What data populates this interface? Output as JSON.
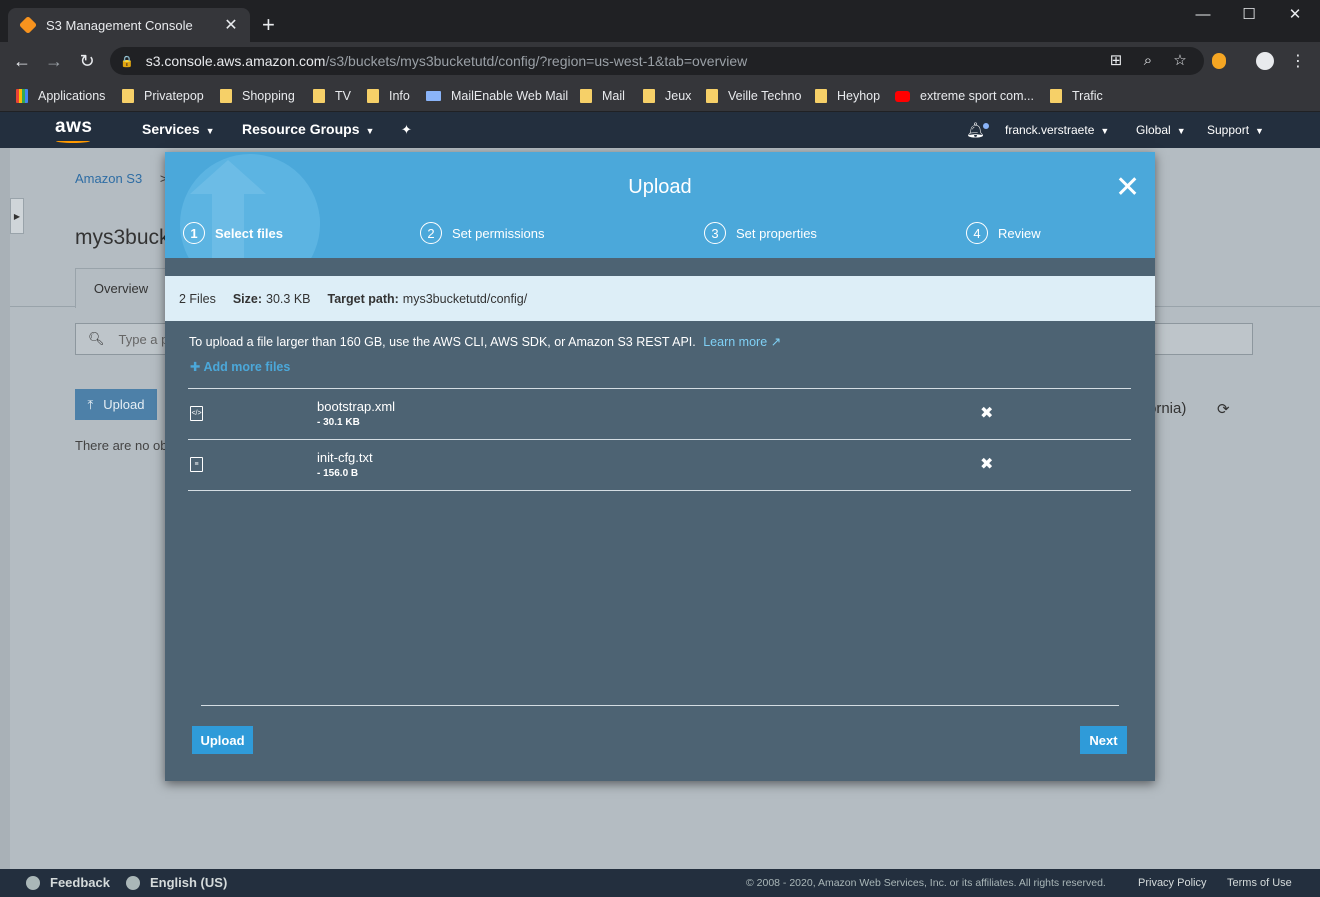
{
  "browser": {
    "tab_title": "S3 Management Console",
    "tab_close": "✕",
    "new_tab": "+",
    "window_controls": [
      "—",
      "☐",
      "✕"
    ],
    "url_host": "s3.console.aws.amazon.com",
    "url_path": "/s3/buckets/mys3bucketutd/config/?region=us-west-1&tab=overview",
    "bookmarks": [
      {
        "label": "Applications",
        "icon": "grid"
      },
      {
        "label": "Privatepop",
        "icon": "folder"
      },
      {
        "label": "Shopping",
        "icon": "folder"
      },
      {
        "label": "TV",
        "icon": "folder"
      },
      {
        "label": "Info",
        "icon": "folder"
      },
      {
        "label": "MailEnable Web Mail",
        "icon": "mail"
      },
      {
        "label": "Mail",
        "icon": "folder"
      },
      {
        "label": "Jeux",
        "icon": "folder"
      },
      {
        "label": "Veille Techno",
        "icon": "folder"
      },
      {
        "label": "Heyhop",
        "icon": "folder"
      },
      {
        "label": "extreme sport com...",
        "icon": "youtube"
      },
      {
        "label": "Trafic",
        "icon": "folder"
      }
    ]
  },
  "aws_nav": {
    "logo": "aws",
    "services": "Services",
    "resource_groups": "Resource Groups",
    "user": "franck.verstraete",
    "region": "Global",
    "support": "Support"
  },
  "background": {
    "breadcrumb": "Amazon S3",
    "breadcrumb_sep": ">",
    "bucket_title": "mys3buck",
    "tab_overview": "Overview",
    "search_placeholder": "Type a pr",
    "upload_label": "Upload",
    "region_text": "ornia)",
    "empty_text": "There are no obj"
  },
  "modal": {
    "title": "Upload",
    "steps": [
      {
        "num": "1",
        "label": "Select files"
      },
      {
        "num": "2",
        "label": "Set permissions"
      },
      {
        "num": "3",
        "label": "Set properties"
      },
      {
        "num": "4",
        "label": "Review"
      }
    ],
    "summary": {
      "files": "2 Files",
      "size_label": "Size:",
      "size_value": "30.3 KB",
      "path_label": "Target path:",
      "path_value": "mys3bucketutd/config/"
    },
    "info": "To upload a file larger than 160 GB, use the AWS CLI, AWS SDK, or Amazon S3 REST API.",
    "learn_more": "Learn more",
    "add_more": "Add more files",
    "files": [
      {
        "name": "bootstrap.xml",
        "size": "- 30.1 KB"
      },
      {
        "name": "init-cfg.txt",
        "size": "- 156.0 B"
      }
    ],
    "upload_button": "Upload",
    "next_button": "Next"
  },
  "footer": {
    "feedback": "Feedback",
    "language": "English (US)",
    "copyright": "© 2008 - 2020, Amazon Web Services, Inc. or its affiliates. All rights reserved.",
    "privacy": "Privacy Policy",
    "terms": "Terms of Use"
  }
}
